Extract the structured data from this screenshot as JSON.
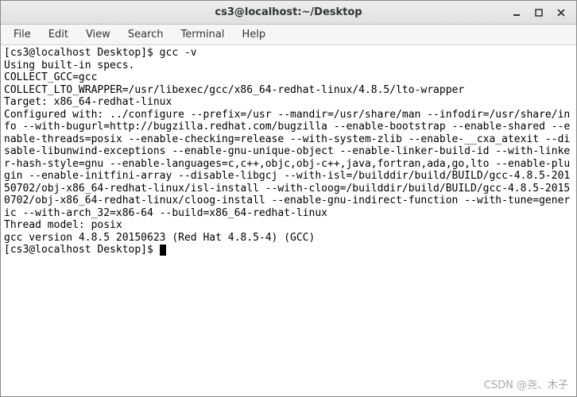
{
  "window": {
    "title": "cs3@localhost:~/Desktop"
  },
  "menubar": {
    "items": [
      "File",
      "Edit",
      "View",
      "Search",
      "Terminal",
      "Help"
    ]
  },
  "terminal": {
    "prompt1": "[cs3@localhost Desktop]$ ",
    "command1": "gcc -v",
    "output": "Using built-in specs.\nCOLLECT_GCC=gcc\nCOLLECT_LTO_WRAPPER=/usr/libexec/gcc/x86_64-redhat-linux/4.8.5/lto-wrapper\nTarget: x86_64-redhat-linux\nConfigured with: ../configure --prefix=/usr --mandir=/usr/share/man --infodir=/usr/share/info --with-bugurl=http://bugzilla.redhat.com/bugzilla --enable-bootstrap --enable-shared --enable-threads=posix --enable-checking=release --with-system-zlib --enable-__cxa_atexit --disable-libunwind-exceptions --enable-gnu-unique-object --enable-linker-build-id --with-linker-hash-style=gnu --enable-languages=c,c++,objc,obj-c++,java,fortran,ada,go,lto --enable-plugin --enable-initfini-array --disable-libgcj --with-isl=/builddir/build/BUILD/gcc-4.8.5-20150702/obj-x86_64-redhat-linux/isl-install --with-cloog=/builddir/build/BUILD/gcc-4.8.5-20150702/obj-x86_64-redhat-linux/cloog-install --enable-gnu-indirect-function --with-tune=generic --with-arch_32=x86-64 --build=x86_64-redhat-linux\nThread model: posix\ngcc version 4.8.5 20150623 (Red Hat 4.8.5-4) (GCC)",
    "prompt2": "[cs3@localhost Desktop]$ "
  },
  "watermark": "CSDN @尧、木子"
}
